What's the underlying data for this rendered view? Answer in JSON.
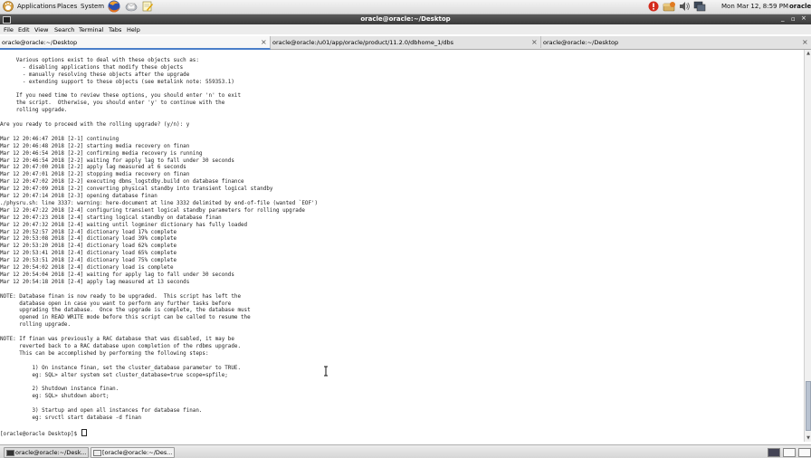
{
  "top_panel": {
    "applications": "Applications",
    "places": "Places",
    "system": "System",
    "datetime": "Mon Mar 12,  8:59 PM",
    "user": "oracle"
  },
  "window": {
    "title": "oracle@oracle:~/Desktop",
    "minimize": "_",
    "maximize": "▫",
    "close": "×"
  },
  "menu": [
    "File",
    "Edit",
    "View",
    "Search",
    "Terminal",
    "Tabs",
    "Help"
  ],
  "tabs": [
    {
      "label": "oracle@oracle:~/Desktop",
      "close": "×"
    },
    {
      "label": "oracle@oracle:/u01/app/oracle/product/11.2.0/dbhome_1/dbs",
      "close": "×"
    },
    {
      "label": "oracle@oracle:~/Desktop",
      "close": "×"
    }
  ],
  "terminal_lines": [
    "",
    "     Various options exist to deal with these objects such as:",
    "       - disabling applications that modify these objects",
    "       - manually resolving these objects after the upgrade",
    "       - extending support to these objects (see metalink note: 559353.1)",
    "",
    "     If you need time to review these options, you should enter 'n' to exit",
    "     the script.  Otherwise, you should enter 'y' to continue with the",
    "     rolling upgrade.",
    "",
    "Are you ready to proceed with the rolling upgrade? (y/n): y",
    "",
    "Mar 12 20:46:47 2018 [2-1] continuing",
    "Mar 12 20:46:48 2018 [2-2] starting media recovery on finan",
    "Mar 12 20:46:54 2018 [2-2] confirming media recovery is running",
    "Mar 12 20:46:54 2018 [2-2] waiting for apply lag to fall under 30 seconds",
    "Mar 12 20:47:00 2018 [2-2] apply lag measured at 6 seconds",
    "Mar 12 20:47:01 2018 [2-2] stopping media recovery on finan",
    "Mar 12 20:47:02 2018 [2-2] executing dbms_logstdby.build on database finance",
    "Mar 12 20:47:09 2018 [2-2] converting physical standby into transient logical standby",
    "Mar 12 20:47:14 2018 [2-3] opening database finan",
    "./physru.sh: line 3337: warning: here-document at line 3332 delimited by end-of-file (wanted `EOF')",
    "Mar 12 20:47:22 2018 [2-4] configuring transient logical standby parameters for rolling upgrade",
    "Mar 12 20:47:23 2018 [2-4] starting logical standby on database finan",
    "Mar 12 20:47:32 2018 [2-4] waiting until logminer dictionary has fully loaded",
    "Mar 12 20:52:57 2018 [2-4] dictionary load 17% complete",
    "Mar 12 20:53:08 2018 [2-4] dictionary load 39% complete",
    "Mar 12 20:53:20 2018 [2-4] dictionary load 62% complete",
    "Mar 12 20:53:41 2018 [2-4] dictionary load 65% complete",
    "Mar 12 20:53:51 2018 [2-4] dictionary load 75% complete",
    "Mar 12 20:54:02 2018 [2-4] dictionary load is complete",
    "Mar 12 20:54:04 2018 [2-4] waiting for apply lag to fall under 30 seconds",
    "Mar 12 20:54:18 2018 [2-4] apply lag measured at 13 seconds",
    "",
    "NOTE: Database finan is now ready to be upgraded.  This script has left the",
    "      database open in case you want to perform any further tasks before",
    "      upgrading the database.  Once the upgrade is complete, the database must",
    "      opened in READ WRITE mode before this script can be called to resume the",
    "      rolling upgrade.",
    "",
    "NOTE: If finan was previously a RAC database that was disabled, it may be",
    "      reverted back to a RAC database upon completion of the rdbms upgrade.",
    "      This can be accomplished by performing the following steps:",
    "",
    "          1) On instance finan, set the cluster_database parameter to TRUE.",
    "          eg: SQL> alter system set cluster_database=true scope=spfile;",
    "",
    "          2) Shutdown instance finan.",
    "          eg: SQL> shutdown abort;",
    "",
    "          3) Startup and open all instances for database finan.",
    "          eg: srvctl start database -d finan",
    "",
    "[oracle@oracle Desktop]$ "
  ],
  "taskbar": [
    {
      "label": "oracle@oracle:~/Desk..."
    },
    {
      "label": "[oracle@oracle:~/Des..."
    }
  ]
}
